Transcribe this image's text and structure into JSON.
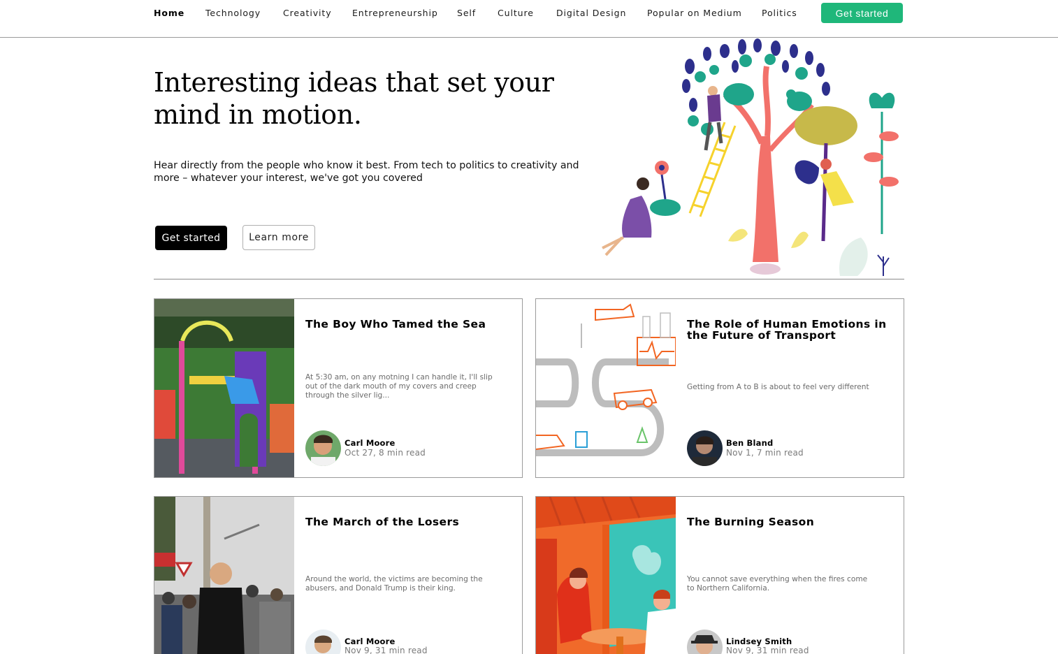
{
  "nav": {
    "items": [
      {
        "label": "Home",
        "active": true
      },
      {
        "label": "Technology",
        "active": false
      },
      {
        "label": "Creativity",
        "active": false
      },
      {
        "label": "Entrepreneurship",
        "active": false
      },
      {
        "label": "Self",
        "active": false
      },
      {
        "label": "Culture",
        "active": false
      },
      {
        "label": "Digital Design",
        "active": false
      },
      {
        "label": "Popular on Medium",
        "active": false
      },
      {
        "label": "Politics",
        "active": false
      }
    ],
    "cta_label": "Get started",
    "cta_color": "#1fb77a"
  },
  "hero": {
    "title": "Interesting ideas that set your mind in motion.",
    "subtitle": "Hear directly from the people who know it best. From tech to politics to creativity and more – whatever your interest, we've got you covered",
    "primary_button": "Get started",
    "secondary_button": "Learn more",
    "illustration_icon": "tree-people-illustration"
  },
  "cards": [
    {
      "title": "The Boy Who Tamed the Sea",
      "excerpt": "At 5:30 am, on any motning I can handle it, I'll slip out of the dark mouth of my covers and creep through the silver lig...",
      "author": "Carl Moore",
      "meta": "Oct 27, 8 min read",
      "image": "playground-photo"
    },
    {
      "title": "The Role of Human Emotions in the Future of Transport",
      "excerpt": "Getting from A to B is about to feel very different",
      "author": "Ben Bland",
      "meta": "Nov 1, 7 min read",
      "image": "transport-line-illustration"
    },
    {
      "title": "The March of the Losers",
      "excerpt": "Around the world, the victims are becoming the abusers, and Donald Trump is their king.",
      "author": "Carl Moore",
      "meta": "Nov 9, 31 min read",
      "image": "street-crowd-photo"
    },
    {
      "title": "The Burning Season",
      "excerpt": "You cannot save everything when the fires come to Northern California.",
      "author": "Lindsey Smith",
      "meta": "Nov 9, 31 min read",
      "image": "burning-season-illustration"
    }
  ]
}
